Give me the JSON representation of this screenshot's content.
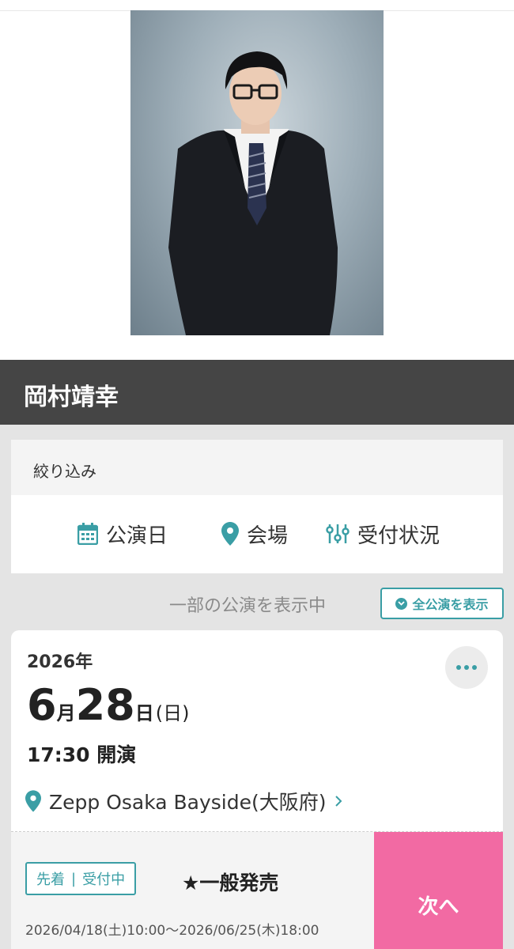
{
  "artist": {
    "name": "岡村靖幸"
  },
  "filter": {
    "title": "絞り込み",
    "options": [
      {
        "label": "公演日",
        "icon": "calendar-icon"
      },
      {
        "label": "会場",
        "icon": "map-pin-icon"
      },
      {
        "label": "受付状況",
        "icon": "sliders-icon"
      }
    ]
  },
  "listing": {
    "partial_text": "一部の公演を表示中",
    "show_all_label": "全公演を表示"
  },
  "event": {
    "year": "2026年",
    "month": "6",
    "month_unit": "月",
    "day": "28",
    "day_unit": "日",
    "weekday": "(日)",
    "time": "17:30 開演",
    "venue": "Zepp Osaka Bayside(大阪府)",
    "badge_type": "先着",
    "badge_status": "受付中",
    "sale_name": "★一般発売",
    "sale_period": "2026/04/18(土)10:00〜2026/06/25(木)18:00",
    "next_label": "次へ"
  },
  "colors": {
    "accent": "#3a9ea5",
    "next_button": "#f26aa3",
    "header_bar": "#454545"
  }
}
